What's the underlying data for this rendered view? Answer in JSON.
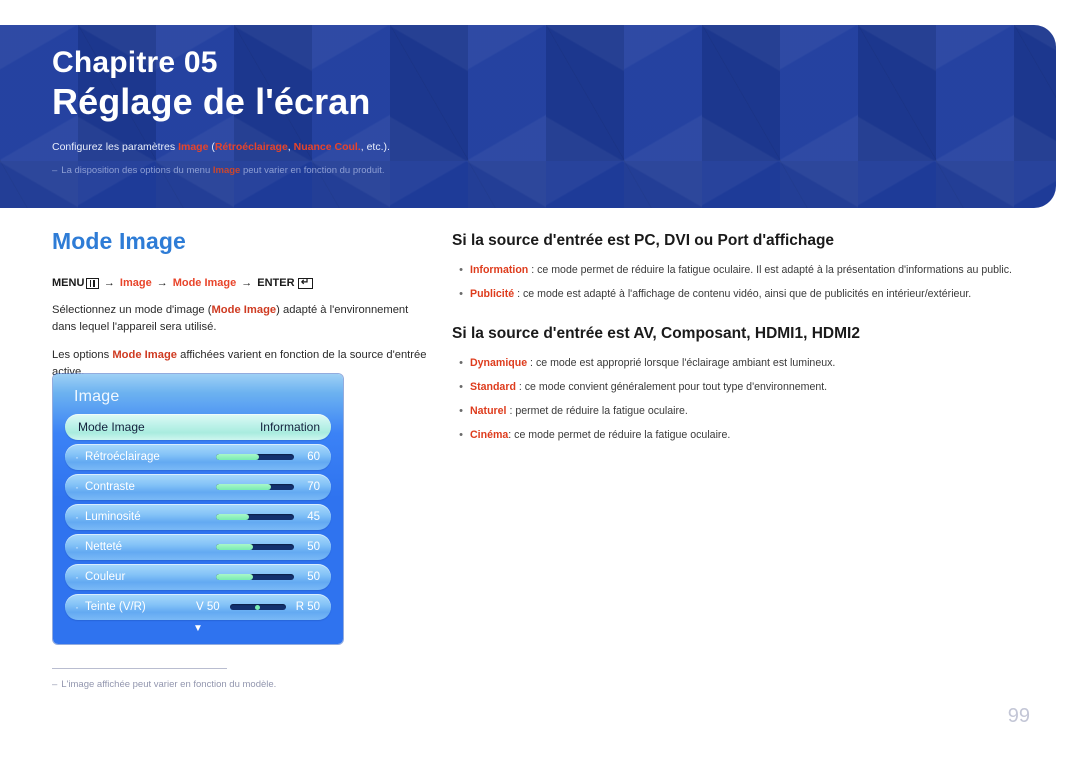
{
  "banner": {
    "kicker": "Chapitre 05",
    "title": "Réglage de l'écran",
    "subtitle_prefix": "Configurez les paramètres ",
    "subtitle_hl1": "Image",
    "subtitle_mid1": " (",
    "subtitle_hl2": "Rétroéclairage",
    "subtitle_mid2": ", ",
    "subtitle_hl3": "Nuance Coul.",
    "subtitle_suffix": ", etc.).",
    "note_dash": "‒",
    "note_prefix": "La disposition des options du menu ",
    "note_hl": "Image",
    "note_suffix": " peut varier en fonction du produit.",
    "accent_blue": "#1f3d9e",
    "accent_red": "#e8442a"
  },
  "left": {
    "heading": "Mode Image",
    "menu_path": {
      "menu_label": "MENU",
      "menu_icon": "menu-bars-icon",
      "arrow1": "→",
      "item1": "Image",
      "arrow2": "→",
      "item2": "Mode Image",
      "arrow3": "→",
      "enter_label": "ENTER",
      "enter_icon": "enter-return-icon",
      "enter_glyph": "↵"
    },
    "para1_a": "Sélectionnez un mode d'image (",
    "para1_b": "Mode Image",
    "para1_c": ") adapté à l'environnement dans lequel l'appareil sera utilisé.",
    "para2_a": "Les options ",
    "para2_b": "Mode Image",
    "para2_c": " affichées varient en fonction de la source d'entrée active."
  },
  "osd": {
    "title": "Image",
    "down_arrow": "▼",
    "rows": [
      {
        "bullet": "",
        "label": "Mode Image",
        "value": "Information",
        "type": "select",
        "selected": true
      },
      {
        "bullet": "·",
        "label": "Rétroéclairage",
        "value": "60",
        "type": "slider",
        "fill_pct": 55,
        "selected": false
      },
      {
        "bullet": "·",
        "label": "Contraste",
        "value": "70",
        "type": "slider",
        "fill_pct": 70,
        "selected": false
      },
      {
        "bullet": "·",
        "label": "Luminosité",
        "value": "45",
        "type": "slider",
        "fill_pct": 42,
        "selected": false
      },
      {
        "bullet": "·",
        "label": "Netteté",
        "value": "50",
        "type": "slider",
        "fill_pct": 48,
        "selected": false
      },
      {
        "bullet": "·",
        "label": "Couleur",
        "value": "50",
        "type": "slider",
        "fill_pct": 48,
        "selected": false
      },
      {
        "bullet": "·",
        "label": "Teinte (V/R)",
        "type": "tint",
        "left_label": "V 50",
        "right_label": "R 50",
        "selected": false
      }
    ]
  },
  "footnote": {
    "dash": "‒",
    "text": "L'image affichée peut varier en fonction du modèle."
  },
  "right": {
    "section1": {
      "heading": "Si la source d'entrée est PC, DVI ou Port d'affichage",
      "bullets": [
        {
          "marker": "•",
          "term": "Information",
          "rest": " : ce mode permet de réduire la fatigue oculaire. Il est adapté à la présentation d'informations au public."
        },
        {
          "marker": "•",
          "term": "Publicité",
          "rest": " : ce mode est adapté à l'affichage de contenu vidéo, ainsi que de publicités en intérieur/extérieur."
        }
      ]
    },
    "section2": {
      "heading": "Si la source d'entrée est AV, Composant, HDMI1, HDMI2",
      "bullets": [
        {
          "marker": "•",
          "term": "Dynamique",
          "rest": " : ce mode est approprié lorsque l'éclairage ambiant est lumineux."
        },
        {
          "marker": "•",
          "term": "Standard",
          "rest": " : ce mode convient généralement pour tout type d'environnement."
        },
        {
          "marker": "•",
          "term": "Naturel",
          "rest": " : permet de réduire la fatigue oculaire."
        },
        {
          "marker": "•",
          "term": "Cinéma",
          "rest": ": ce mode permet de réduire la fatigue oculaire."
        }
      ]
    }
  },
  "page_number": "99"
}
